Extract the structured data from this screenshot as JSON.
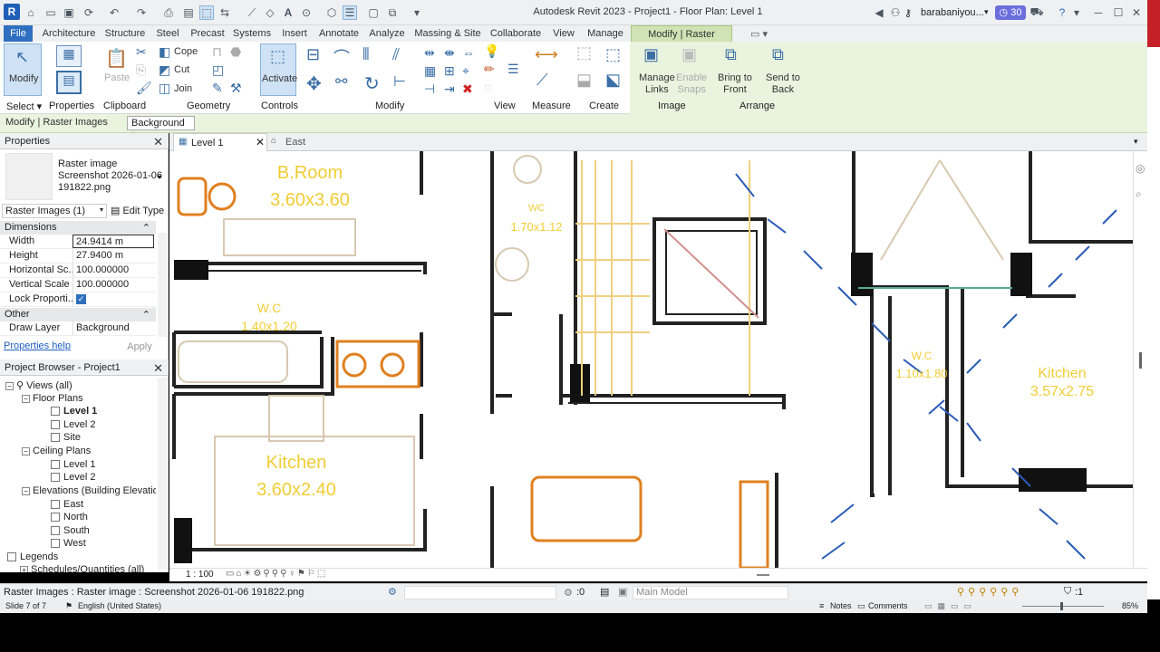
{
  "window": {
    "title": "Autodesk Revit 2023 - Project1 - Floor Plan: Level 1",
    "user": "barabaniyou...",
    "timer": "30"
  },
  "ribbon_tabs": [
    "File",
    "Architecture",
    "Structure",
    "Steel",
    "Precast",
    "Systems",
    "Insert",
    "Annotate",
    "Analyze",
    "Massing & Site",
    "Collaborate",
    "View",
    "Manage",
    "Modify | Raster Images"
  ],
  "ribbon": {
    "modify": "Modify",
    "paste": "Paste",
    "cope": "Cope",
    "cut": "Cut",
    "join": "Join",
    "activate": "Activate",
    "manage_links": [
      "Manage",
      "Links"
    ],
    "enable_snaps": [
      "Enable",
      "Snaps"
    ],
    "bring_front": [
      "Bring to",
      "Front"
    ],
    "send_back": [
      "Send to",
      "Back"
    ],
    "panels": [
      "Select",
      "Properties",
      "Clipboard",
      "Geometry",
      "Controls",
      "Modify",
      "View",
      "Measure",
      "Create",
      "Image",
      "Arrange"
    ]
  },
  "options_bar": {
    "context": "Modify | Raster Images",
    "draw_layer_select": "Background"
  },
  "properties": {
    "header": "Properties",
    "type_name": "Raster image",
    "file_name_1": "Screenshot 2026-01-06",
    "file_name_2": "191822.png",
    "selector": "Raster Images (1)",
    "edit_type": "Edit Type",
    "groups": {
      "dimensions": "Dimensions",
      "other": "Other"
    },
    "rows": [
      {
        "k": "Width",
        "v": "24.9414 m"
      },
      {
        "k": "Height",
        "v": "27.9400 m"
      },
      {
        "k": "Horizontal Sc...",
        "v": "100.000000"
      },
      {
        "k": "Vertical Scale",
        "v": "100.000000"
      },
      {
        "k": "Lock Proporti...",
        "v": "✓"
      },
      {
        "k": "Draw Layer",
        "v": "Background"
      }
    ],
    "help": "Properties help",
    "apply": "Apply"
  },
  "browser": {
    "header": "Project Browser - Project1",
    "items": [
      "Views (all)",
      "Floor Plans",
      "Level 1",
      "Level 2",
      "Site",
      "Ceiling Plans",
      "Level 1",
      "Level 2",
      "Elevations (Building Elevatio",
      "East",
      "North",
      "South",
      "West",
      "Legends",
      "Schedules/Quantities (all)"
    ]
  },
  "view_tabs": [
    "Level 1",
    "East"
  ],
  "plan_labels": {
    "broom": "B.Room",
    "broom_dim": "3.60x3.60",
    "wc1": "W.C",
    "wc1_dim": "1.40x1.20",
    "wc2": "WC",
    "wc2_dim": "1.70x1.12",
    "kitchen1": "Kitchen",
    "kitchen1_dim": "3.60x2.40",
    "kitchen2": "Kitchen",
    "kitchen2_dim": "3.57x2.75",
    "wc3": "W.C",
    "wc3_dim": "1.10x1.80"
  },
  "view_control": {
    "scale": "1 : 100"
  },
  "status": {
    "text": "Raster Images : Raster image : Screenshot 2026-01-06 191822.png",
    "zero": ":0",
    "model": "Main Model",
    "filter": ":1"
  },
  "taskbar": {
    "slide": "Slide 7 of 7",
    "lang": "English (United States)",
    "notes": "Notes",
    "comments": "Comments",
    "zoom": "85%"
  }
}
